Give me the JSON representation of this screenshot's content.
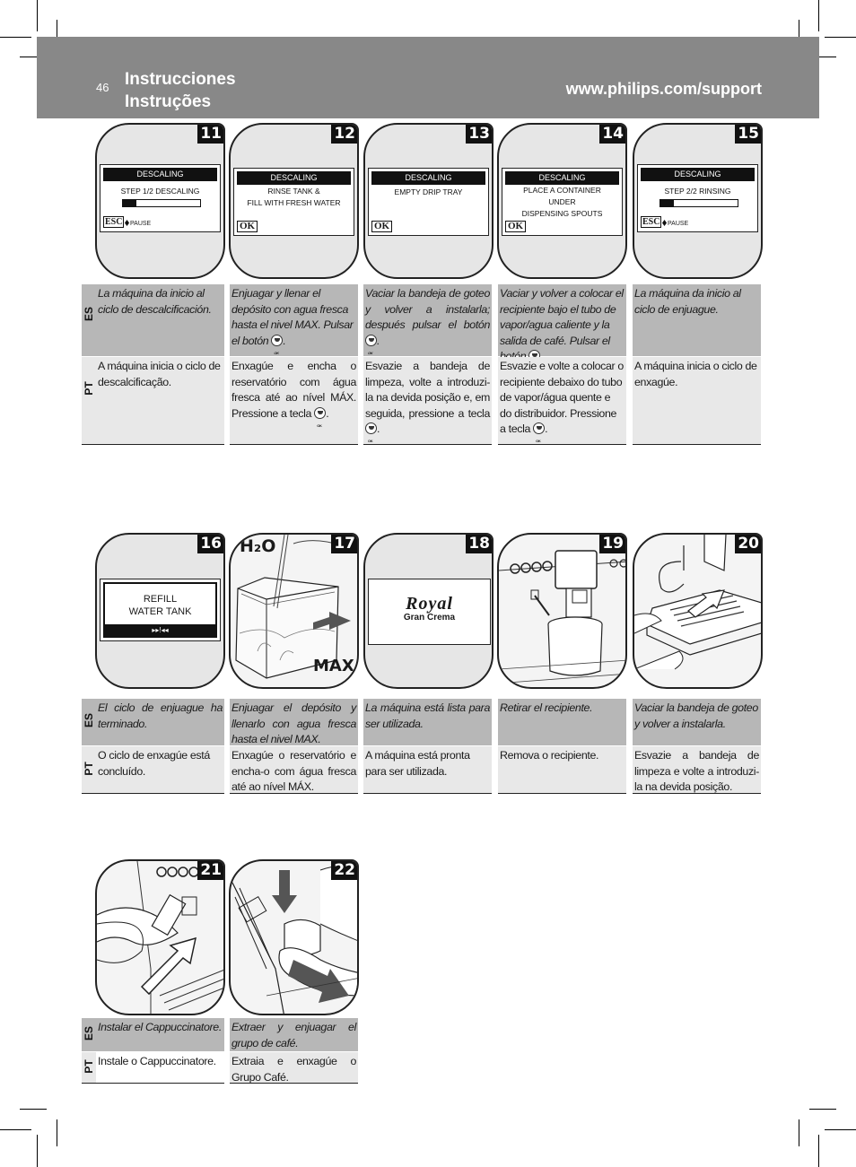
{
  "header": {
    "page_number": "46",
    "title_es": "Instrucciones",
    "title_pt": "Instruções",
    "website": "www.philips.com/support"
  },
  "languages": {
    "es": "ES",
    "pt": "PT"
  },
  "steps": [
    {
      "number": "11",
      "display": {
        "header": "DESCALING",
        "lines": [
          "STEP 1/2 DESCALING"
        ],
        "progress": 0.17,
        "esc_label": "ESC",
        "pause_label": "PAUSE"
      },
      "es": "La máquina da inicio al ciclo de descalcificación.",
      "pt": "A máquina inicia o ciclo de descalcificação."
    },
    {
      "number": "12",
      "display": {
        "header": "DESCALING",
        "lines": [
          "RINSE TANK &",
          "FILL WITH FRESH WATER"
        ],
        "ok_label": "OK"
      },
      "es": "Enjuagar y llenar el depósito con agua fresca hasta el nivel MAX. Pulsar el botón",
      "pt": "Enxagúe e encha o reservatório com água fresca até ao nível MÁX. Pressione a tecla"
    },
    {
      "number": "13",
      "display": {
        "header": "DESCALING",
        "lines": [
          "EMPTY DRIP TRAY"
        ],
        "ok_label": "OK"
      },
      "es": "Vaciar la bandeja de goteo y volver a instalarla; después pulsar el botón",
      "pt": "Esvazie a bandeja de limpeza, volte a introduzi-la na devida posição e, em seguida, pressione a tecla"
    },
    {
      "number": "14",
      "display": {
        "header": "DESCALING",
        "lines": [
          "PLACE A CONTAINER",
          "UNDER",
          "DISPENSING SPOUTS"
        ],
        "ok_label": "OK"
      },
      "es": "Vaciar y volver a colocar el recipiente bajo el tubo de vapor/agua caliente y la salida de café. Pulsar el botón",
      "pt": "Esvazie e volte a colocar o recipiente debaixo do tubo de vapor/água quente e do distribuidor. Pressione a tecla"
    },
    {
      "number": "15",
      "display": {
        "header": "DESCALING",
        "lines": [
          "STEP 2/2 RINSING"
        ],
        "progress": 0.17,
        "esc_label": "ESC",
        "pause_label": "PAUSE"
      },
      "es": "La máquina da inicio al ciclo de enjuague.",
      "pt": "A máquina inicia o ciclo de enxagúe."
    },
    {
      "number": "16",
      "display": {
        "lines": [
          "REFILL",
          "WATER TANK"
        ],
        "footer_symbol": "▸▸!◂◂"
      },
      "es": "El ciclo de enjuague ha terminado.",
      "pt": "O ciclo de enxagúe está concluído."
    },
    {
      "number": "17",
      "labels": {
        "h2o": "H₂O",
        "max": "MAX"
      },
      "es": "Enjuagar el depósito y llenarlo con agua fresca hasta el nivel MAX.",
      "pt": "Enxagúe o reservatório e encha-o com água fresca até ao nível MÁX."
    },
    {
      "number": "18",
      "logo": {
        "brand": "Royal",
        "sub": "Gran Crema"
      },
      "es": "La máquina está lista para ser utilizada.",
      "pt": "A máquina está pronta para ser utilizada."
    },
    {
      "number": "19",
      "es": "Retirar el recipiente.",
      "pt": "Remova o recipiente."
    },
    {
      "number": "20",
      "es": "Vaciar la bandeja de goteo y volver a instalarla.",
      "pt": "Esvazie a bandeja de limpeza e volte a introduzi-la na devida posição."
    },
    {
      "number": "21",
      "es": "Instalar el Cappuccinatore.",
      "pt": "Instale o Cappuccinatore."
    },
    {
      "number": "22",
      "es": "Extraer y enjuagar el grupo de café.",
      "pt": "Extraia e enxagúe o Grupo Café."
    }
  ]
}
